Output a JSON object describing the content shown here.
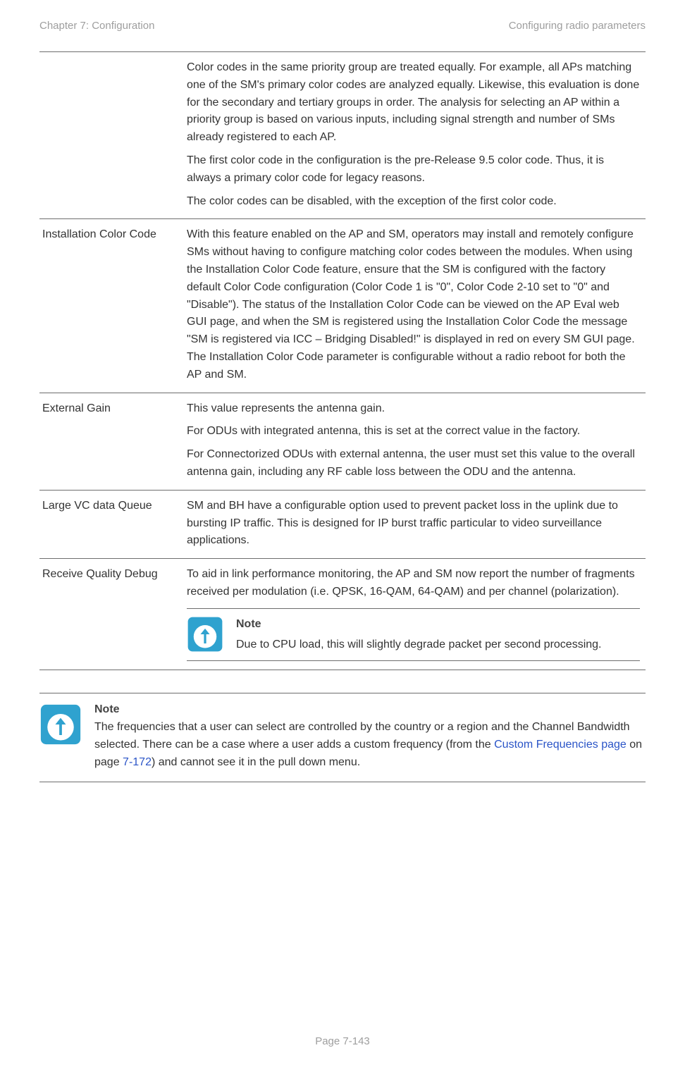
{
  "header": {
    "left": "Chapter 7:  Configuration",
    "right": "Configuring radio parameters"
  },
  "rows": [
    {
      "label": "",
      "paras": [
        "Color codes in the same priority group are treated equally. For example, all APs matching one of the SM's primary color codes are analyzed equally. Likewise, this evaluation is done for the secondary and tertiary groups in order. The analysis for selecting an AP within a priority group is based on various inputs, including signal strength and number of SMs already registered to each AP.",
        "The first color code in the configuration is the pre-Release 9.5 color code. Thus, it is always a primary color code for legacy reasons.",
        "The color codes can be disabled, with the exception of the first color code."
      ]
    },
    {
      "label": "Installation Color Code",
      "paras": [
        "With this feature enabled on the AP and SM, operators may install and remotely configure SMs without having to configure matching color codes between the modules. When using the Installation Color Code feature, ensure that the SM is configured with the factory default Color Code configuration (Color Code 1 is \"0\", Color Code 2-10 set to \"0\" and \"Disable\"). The status of the Installation Color Code can be viewed on the AP Eval web GUI page, and when the SM is registered using the Installation Color Code the message \"SM is registered via ICC – Bridging Disabled!\" is displayed in red on every SM GUI page. The Installation Color Code parameter is configurable without a radio reboot for both the AP and SM."
      ]
    },
    {
      "label": "External Gain",
      "paras": [
        "This value represents the antenna gain.",
        "For ODUs with integrated antenna, this is set at the correct value in the factory.",
        "For Connectorized ODUs with external antenna, the user must set this value to the overall antenna gain, including any RF cable loss between the ODU and the antenna."
      ]
    },
    {
      "label": "Large VC data Queue",
      "paras": [
        "SM and BH have a configurable option used to prevent packet loss in the uplink due to bursting IP traffic. This is designed for IP burst traffic particular to video surveillance applications."
      ]
    },
    {
      "label": "Receive Quality Debug",
      "paras": [
        "To aid in link performance monitoring, the AP and SM now report the number of fragments received per modulation (i.e. QPSK, 16-QAM, 64-QAM) and per channel (polarization)."
      ],
      "note": {
        "label": "Note",
        "text": "Due to CPU load, this will slightly degrade packet per second processing."
      }
    }
  ],
  "bottom_note": {
    "label": "Note",
    "prefix": "The frequencies that a user can select are controlled by the country or a region and the Channel Bandwidth selected. There can be a case where a user adds a custom frequency (from the ",
    "link_text": "Custom Frequencies page",
    "mid": " on page ",
    "page_ref": "7-172",
    "suffix": ") and cannot see it in the pull down menu."
  },
  "footer": "Page 7-143"
}
